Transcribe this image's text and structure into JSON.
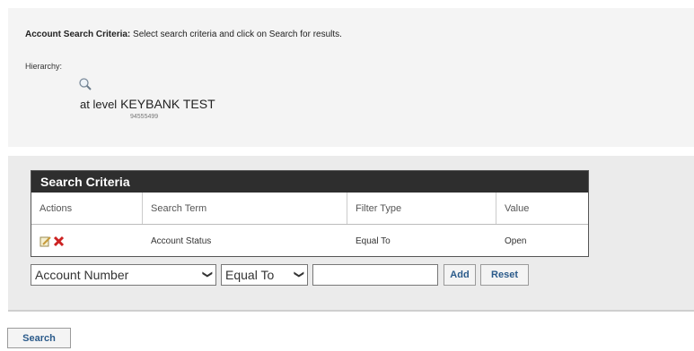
{
  "header": {
    "criteria_label": "Account Search Criteria:",
    "criteria_text": "Select search criteria and click on Search for results.",
    "hierarchy_label": "Hierarchy:",
    "level_prefix": "at level",
    "level_name": "KEYBANK TEST",
    "level_id": "94555499"
  },
  "search_criteria": {
    "title": "Search Criteria",
    "columns": [
      "Actions",
      "Search Term",
      "Filter Type",
      "Value"
    ],
    "rows": [
      {
        "search_term": "Account Status",
        "filter_type": "Equal To",
        "value": "Open"
      }
    ],
    "row_action_icons": [
      "edit-icon",
      "delete-icon"
    ]
  },
  "controls": {
    "field_select": "Account Number",
    "filter_select": "Equal To",
    "value_input": "",
    "add_label": "Add",
    "reset_label": "Reset"
  },
  "footer": {
    "search_label": "Search"
  },
  "colors": {
    "header_bg": "#2e2e2e",
    "button_text": "#2a5a8a",
    "delete_icon": "#cc2222"
  }
}
